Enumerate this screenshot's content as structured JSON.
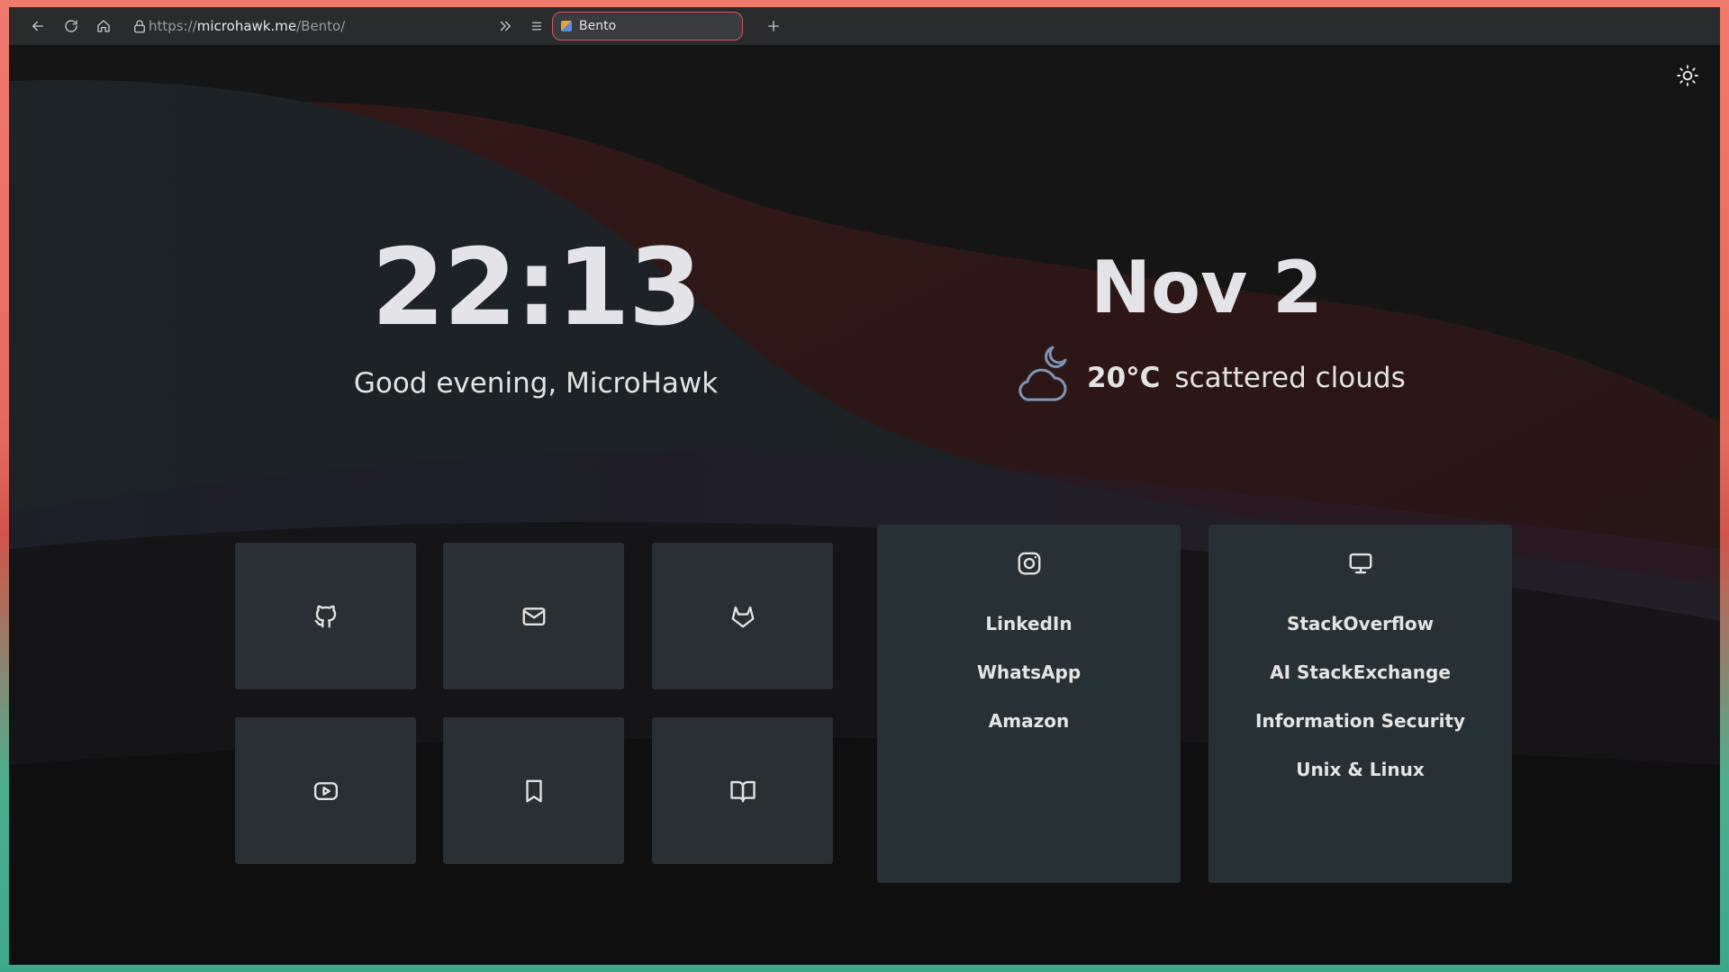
{
  "browser": {
    "url_scheme": "https://",
    "url_host": "microhawk.me",
    "url_path": "/Bento/",
    "tab_title": "Bento",
    "icons": [
      "back-arrow-icon",
      "reload-icon",
      "home-icon",
      "lock-icon",
      "overflow-chevrons-icon",
      "menu-icon",
      "new-tab-plus-icon"
    ]
  },
  "page": {
    "clock": "22:13",
    "greeting": "Good evening, MicroHawk",
    "date": "Nov 2",
    "weather": {
      "temperature": "20°C",
      "condition": "scattered clouds",
      "icon": "cloud-moon-icon"
    },
    "theme_toggle_icon": "sun-icon",
    "tiles": [
      {
        "icon": "github-icon"
      },
      {
        "icon": "mail-icon"
      },
      {
        "icon": "gitlab-icon"
      },
      {
        "icon": "youtube-icon"
      },
      {
        "icon": "bookmark-icon"
      },
      {
        "icon": "book-open-icon"
      }
    ],
    "lists": [
      {
        "icon": "instagram-icon",
        "links": [
          "LinkedIn",
          "WhatsApp",
          "Amazon"
        ]
      },
      {
        "icon": "monitor-icon",
        "links": [
          "StackOverflow",
          "AI StackExchange",
          "Information Security",
          "Unix & Linux"
        ]
      }
    ]
  },
  "colors": {
    "accent_tab_border": "#d8555a",
    "tile_bg": "#2a2f33",
    "card_bg": "#273034",
    "text": "#e3e3e8"
  }
}
